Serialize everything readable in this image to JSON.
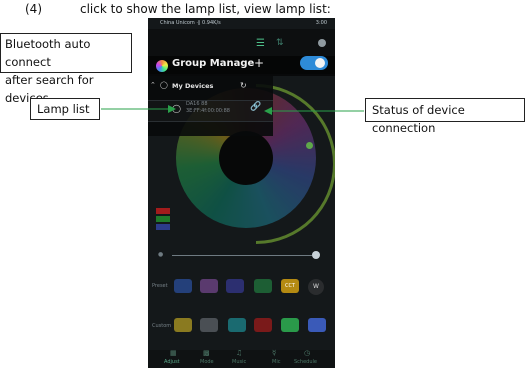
{
  "instruction": {
    "number": "(4)",
    "text": "click to show the lamp list, view lamp list:"
  },
  "callouts": {
    "bluetooth_line1": "Bluetooth auto connect",
    "bluetooth_line2": "after search for devices",
    "lamp_list": "Lamp list",
    "status": "Status of device connection"
  },
  "phone": {
    "status_bar": {
      "carrier": "China Unicom ·∥ 0.94K/s",
      "time": "3:00"
    },
    "header": {
      "title": "Group Manage",
      "plus": "+"
    },
    "devices": {
      "section_title": "My Devices",
      "device_name": "DA16 88",
      "device_mac": "3E:FF:4f:00:00:88"
    },
    "rows": {
      "preset_label": "Preset",
      "preset_badge": "CCT",
      "preset_w": "W",
      "custom_label": "Custom"
    },
    "tabs": [
      "Adjust",
      "Mode",
      "Music",
      "Mic",
      "Schedule"
    ]
  },
  "colors": {
    "arrow": "#2aa04a",
    "accent": "#2e8bd8",
    "screen_bg": "#14181a"
  }
}
